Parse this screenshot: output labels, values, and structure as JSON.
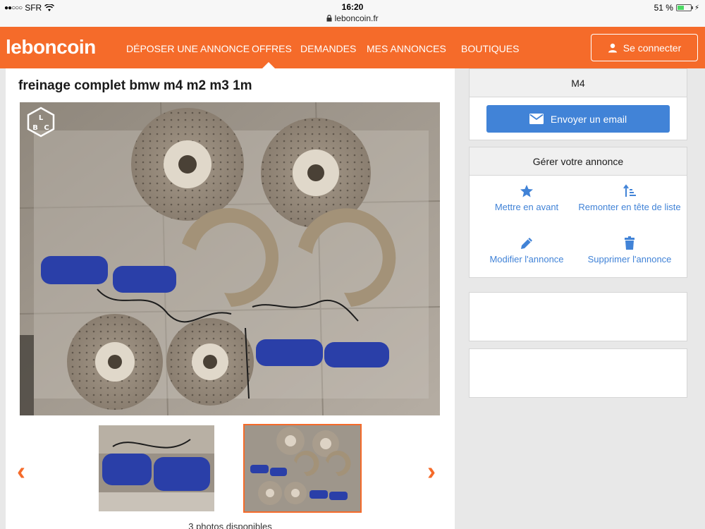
{
  "status_bar": {
    "carrier": "SFR",
    "time": "16:20",
    "url": "leboncoin.fr",
    "battery": "51 %",
    "battery_level": 0.51
  },
  "nav": {
    "logo": "leboncoin",
    "items": [
      "DÉPOSER UNE ANNONCE",
      "OFFRES",
      "DEMANDES",
      "MES ANNONCES",
      "BOUTIQUES"
    ],
    "active_item": "OFFRES",
    "login_label": "Se connecter"
  },
  "ad": {
    "title": "freinage complet bmw m4 m2 m3 1m",
    "photo_count_text": "3 photos disponibles",
    "watermark_letters": "LBC"
  },
  "contact_card": {
    "seller_name": "M4",
    "email_button": "Envoyer un email"
  },
  "manage_card": {
    "title": "Gérer votre annonce",
    "actions": [
      {
        "label": "Mettre en avant",
        "icon": "star-icon"
      },
      {
        "label": "Remonter en tête de liste",
        "icon": "sort-up-icon"
      },
      {
        "label": "Modifier l'annonce",
        "icon": "pencil-icon"
      },
      {
        "label": "Supprimer l'annonce",
        "icon": "trash-icon"
      }
    ]
  },
  "colors": {
    "brand_orange": "#f56b2a",
    "link_blue": "#4183d7",
    "caliper_blue": "#2a3fa8"
  }
}
